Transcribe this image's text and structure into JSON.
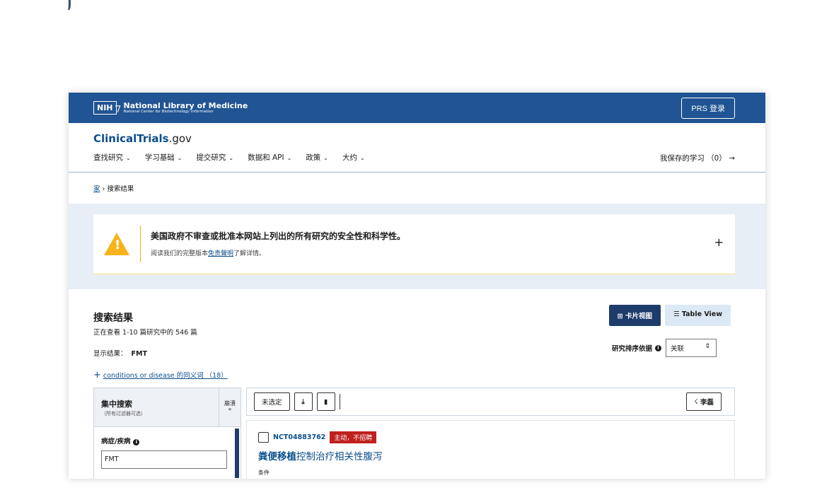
{
  "corner_fragment": "⳨ ̀°",
  "nlm": {
    "nih": "NIH",
    "title": "National Library of Medicine",
    "subtitle": "National Center for Biotechnology Information",
    "prs_button": "PRS 登录"
  },
  "header": {
    "logo_main": "ClinicalTrials",
    "logo_suffix": ".gov",
    "nav": [
      "查找研究",
      "学习基础",
      "提交研究",
      "数据和 API",
      "政策",
      "大约"
    ],
    "saved_studies": "我保存的学习 （0） →"
  },
  "breadcrumb": {
    "home": "家",
    "separator": "›",
    "current": "搜索结果"
  },
  "disclaimer": {
    "title": "美国政府不审查或批准本网站上列出的所有研究的安全性和科学性。",
    "sub_before": "阅读我们的完整版本",
    "sub_link": "免责聲明",
    "sub_after": "了解详情。",
    "expand": "+"
  },
  "results": {
    "title": "搜索结果",
    "count": "正在查看 1-10 篇研究中的 546 篇",
    "showing_label": "显示结果：",
    "showing_value": "FMT",
    "synonyms_plus": "+",
    "synonyms_link": "conditions or disease 的同义词 （18）",
    "card_view": "卡片视图",
    "table_view": "Table View",
    "sort_label": "研究排序依据",
    "sort_value": "关联",
    "sort_arrows": "⌃⌄"
  },
  "filters": {
    "title": "集中搜索",
    "subtitle": "（所有过滤器可选）",
    "collapse": "崩溃\n«",
    "condition_label": "病症/疾病",
    "condition_value": "FMT"
  },
  "toolbar": {
    "unselected": "未选定",
    "download_icon": "⤓",
    "bookmark_icon": "▮",
    "rss_icon": "☇",
    "rss_label": "李磊"
  },
  "study": {
    "nct_id": "NCT04883762",
    "status": "主动，不招聘",
    "title_bold": "粪便移植",
    "title_rest": "控制治疗相关性腹泻",
    "conditions_label": "条件"
  },
  "colors": {
    "nlm_bar": "#205493",
    "link": "#0b4f8b",
    "card_view_button": "#1d3c6b",
    "status_badge": "#c0211e",
    "warning": "#f6b31b"
  }
}
